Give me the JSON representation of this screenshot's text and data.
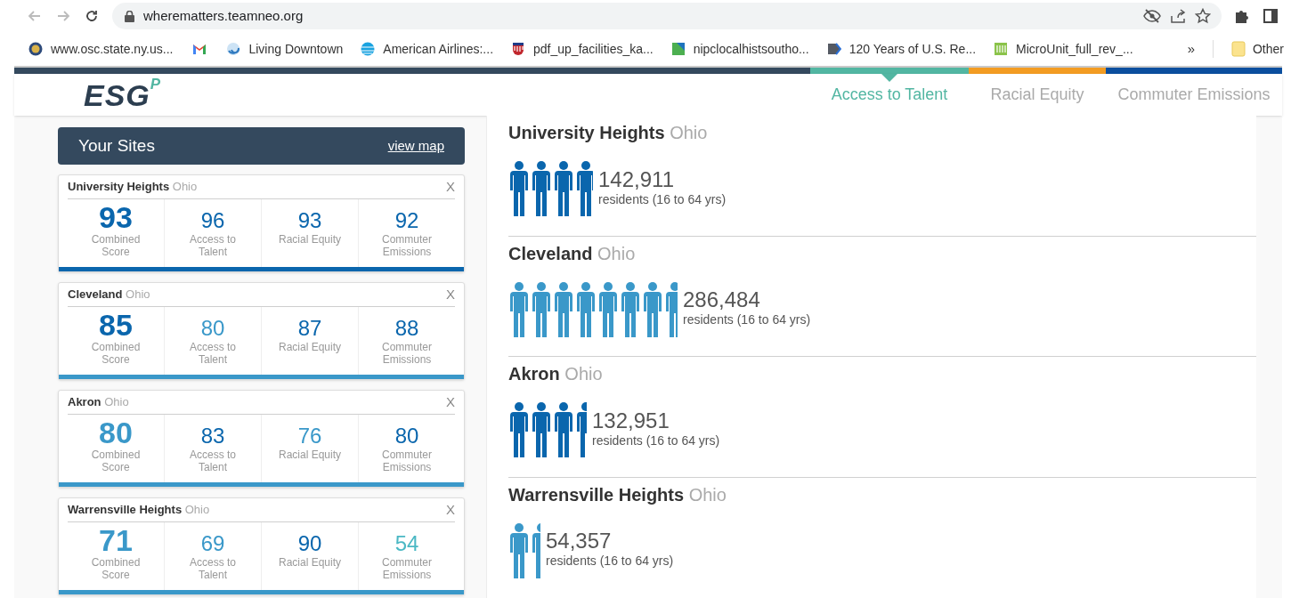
{
  "browser": {
    "url": "wherematters.teamneo.org",
    "bookmarks": [
      {
        "label": "www.osc.state.ny.us..."
      },
      {
        "kind": "icon"
      },
      {
        "label": "Living Downtown"
      },
      {
        "label": "American Airlines:..."
      },
      {
        "label": "pdf_up_facilities_ka..."
      },
      {
        "label": "nipclocalhistsoutho..."
      },
      {
        "label": "120 Years of U.S. Re..."
      },
      {
        "label": "MicroUnit_full_rev_..."
      }
    ],
    "overflow": "»",
    "other": "Other"
  },
  "logo": {
    "text": "ESG",
    "mark": "P"
  },
  "tabs": [
    {
      "label": "Access to Talent",
      "selected": true,
      "color": "#52b6a2"
    },
    {
      "label": "Racial Equity",
      "selected": false,
      "color": "#f39c22"
    },
    {
      "label": "Commuter Emissions",
      "selected": false,
      "color": "#0b4e9e"
    }
  ],
  "sites_panel": {
    "title": "Your Sites",
    "link": "view map"
  },
  "sites": [
    {
      "name": "University Heights",
      "state": "Ohio",
      "close": "X",
      "color": "#0a66ad",
      "scores": [
        {
          "value": "93",
          "label": "Combined Score",
          "color": "#0a66ad"
        },
        {
          "value": "96",
          "label": "Access to Talent",
          "color": "#0a66ad"
        },
        {
          "value": "93",
          "label": "Racial Equity",
          "color": "#0a66ad"
        },
        {
          "value": "92",
          "label": "Commuter Emissions",
          "color": "#0a66ad"
        }
      ]
    },
    {
      "name": "Cleveland",
      "state": "Ohio",
      "close": "X",
      "color": "#3a98c9",
      "scores": [
        {
          "value": "85",
          "label": "Combined Score",
          "color": "#0a66ad"
        },
        {
          "value": "80",
          "label": "Access to Talent",
          "color": "#3a98c9"
        },
        {
          "value": "87",
          "label": "Racial Equity",
          "color": "#0a66ad"
        },
        {
          "value": "88",
          "label": "Commuter Emissions",
          "color": "#0a66ad"
        }
      ]
    },
    {
      "name": "Akron",
      "state": "Ohio",
      "close": "X",
      "color": "#3a98c9",
      "scores": [
        {
          "value": "80",
          "label": "Combined Score",
          "color": "#3a98c9"
        },
        {
          "value": "83",
          "label": "Access to Talent",
          "color": "#0a66ad"
        },
        {
          "value": "76",
          "label": "Racial Equity",
          "color": "#3a98c9"
        },
        {
          "value": "80",
          "label": "Commuter Emissions",
          "color": "#0a66ad"
        }
      ]
    },
    {
      "name": "Warrensville Heights",
      "state": "Ohio",
      "close": "X",
      "color": "#3a98c9",
      "scores": [
        {
          "value": "71",
          "label": "Combined Score",
          "color": "#3a98c9"
        },
        {
          "value": "69",
          "label": "Access to Talent",
          "color": "#3a98c9"
        },
        {
          "value": "90",
          "label": "Racial Equity",
          "color": "#0a66ad"
        },
        {
          "value": "54",
          "label": "Commuter Emissions",
          "color": "#4bb8c4"
        }
      ]
    }
  ],
  "populations": [
    {
      "name": "University Heights",
      "state": "Ohio",
      "color": "#0a66ad",
      "residents": "142,911",
      "residents_label": "residents (16 to 64 yrs)"
    },
    {
      "name": "Cleveland",
      "state": "Ohio",
      "color": "#3a98c9",
      "residents": "286,484",
      "residents_label": "residents (16 to 64 yrs)"
    },
    {
      "name": "Akron",
      "state": "Ohio",
      "color": "#0a66ad",
      "residents": "132,951",
      "residents_label": "residents (16 to 64 yrs)"
    },
    {
      "name": "Warrensville Heights",
      "state": "Ohio",
      "color": "#3a98c9",
      "residents": "54,357",
      "residents_label": "residents (16 to 64 yrs)"
    }
  ]
}
